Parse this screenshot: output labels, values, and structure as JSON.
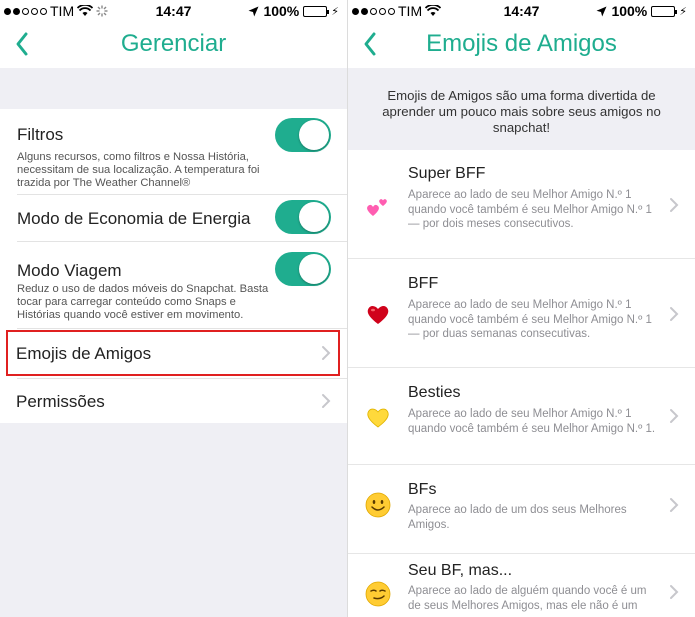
{
  "left": {
    "status": {
      "carrier": "TIM",
      "time": "14:47",
      "battery": "100%"
    },
    "nav": {
      "title": "Gerenciar"
    },
    "settings": [
      {
        "title": "Filtros",
        "desc": "Alguns recursos, como filtros e Nossa História, necessitam de sua localização. A temperatura foi trazida por The Weather Channel®",
        "on": true
      },
      {
        "title": "Modo de Economia de Energia",
        "desc": "",
        "on": true
      },
      {
        "title": "Modo Viagem",
        "desc": "Reduz o uso de dados móveis do Snapchat. Basta tocar para carregar conteúdo como Snaps e Histórias quando você estiver em movimento.",
        "on": true
      }
    ],
    "rows": [
      {
        "label": "Emojis de Amigos"
      },
      {
        "label": "Permissões"
      }
    ]
  },
  "right": {
    "status": {
      "carrier": "TIM",
      "time": "14:47",
      "battery": "100%"
    },
    "nav": {
      "title": "Emojis de Amigos"
    },
    "intro": "Emojis de Amigos são uma forma divertida de aprender um pouco mais sobre seus amigos no snapchat!",
    "items": [
      {
        "title": "Super BFF",
        "desc": "Aparece ao lado de seu Melhor Amigo N.º 1 quando você também é seu Melhor Amigo N.º 1 — por dois meses consecutivos.",
        "icon": "two-hearts-icon"
      },
      {
        "title": "BFF",
        "desc": "Aparece ao lado de seu Melhor Amigo N.º 1 quando você também é seu Melhor Amigo N.º 1 — por duas semanas consecutivas.",
        "icon": "red-heart-icon"
      },
      {
        "title": "Besties",
        "desc": "Aparece ao lado de seu Melhor Amigo N.º 1 quando você também é seu Melhor Amigo N.º 1.",
        "icon": "yellow-heart-icon"
      },
      {
        "title": "BFs",
        "desc": "Aparece ao lado de um dos seus Melhores Amigos.",
        "icon": "smiling-face-icon"
      },
      {
        "title": "Seu BF, mas...",
        "desc": "Aparece ao lado de alguém quando você é um de seus Melhores Amigos, mas ele não é um",
        "icon": "smirking-face-icon"
      }
    ]
  },
  "colors": {
    "accent": "#1fad8f",
    "highlight": "#e02020",
    "background": "#efeff4"
  }
}
